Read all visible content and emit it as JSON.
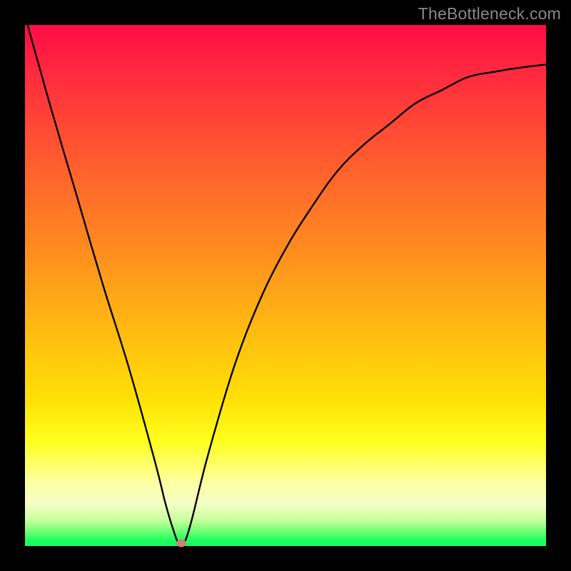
{
  "watermark": "TheBottleneck.com",
  "colors": {
    "gradient_top": "#ff0b46",
    "gradient_mid": "#ffe106",
    "gradient_bottom": "#18ff5f",
    "curve": "#000000",
    "marker": "#cb8276",
    "frame": "#000000"
  },
  "chart_data": {
    "type": "line",
    "title": "",
    "xlabel": "",
    "ylabel": "",
    "xlim": [
      0,
      100
    ],
    "ylim": [
      0,
      100
    ],
    "annotations": [
      "TheBottleneck.com"
    ],
    "series": [
      {
        "name": "bottleneck-curve",
        "x": [
          0.5,
          5,
          10,
          15,
          20,
          25,
          27,
          28.5,
          29.5,
          30.5,
          32,
          35,
          40,
          45,
          50,
          55,
          60,
          65,
          70,
          75,
          80,
          85,
          90,
          95,
          100
        ],
        "y": [
          100,
          84,
          67,
          50,
          34,
          16,
          8,
          3,
          0.5,
          0.5,
          5,
          17,
          34,
          47,
          57,
          65,
          72,
          77,
          81,
          85,
          87.5,
          90,
          91,
          91.8,
          92.4
        ]
      }
    ],
    "marker": {
      "x": 30,
      "y": 0.5
    }
  }
}
